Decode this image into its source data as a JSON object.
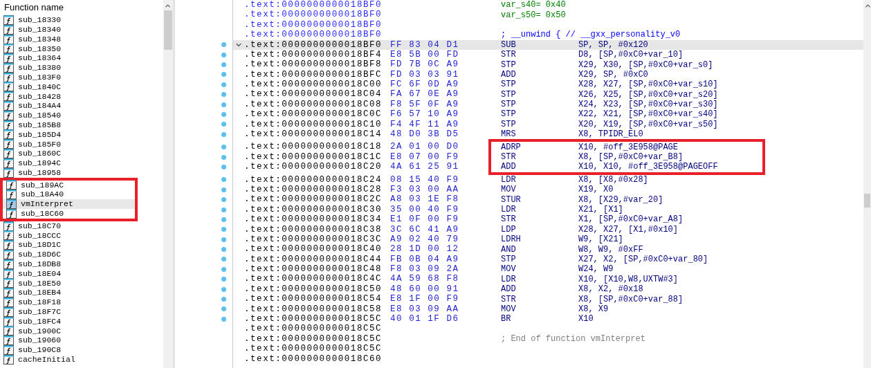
{
  "function_list": {
    "header": "Function name",
    "items": [
      {
        "name": "sub_18330",
        "selected": false,
        "framed": false
      },
      {
        "name": "sub_18340",
        "selected": false,
        "framed": false
      },
      {
        "name": "sub_18348",
        "selected": false,
        "framed": false
      },
      {
        "name": "sub_18350",
        "selected": false,
        "framed": false
      },
      {
        "name": "sub_18364",
        "selected": false,
        "framed": false
      },
      {
        "name": "sub_18380",
        "selected": false,
        "framed": false
      },
      {
        "name": "sub_183F0",
        "selected": false,
        "framed": false
      },
      {
        "name": "sub_1840C",
        "selected": false,
        "framed": false
      },
      {
        "name": "sub_18428",
        "selected": false,
        "framed": false
      },
      {
        "name": "sub_184A4",
        "selected": false,
        "framed": false
      },
      {
        "name": "sub_18540",
        "selected": false,
        "framed": false
      },
      {
        "name": "sub_185B8",
        "selected": false,
        "framed": false
      },
      {
        "name": "sub_185D4",
        "selected": false,
        "framed": false
      },
      {
        "name": "sub_185F0",
        "selected": false,
        "framed": false
      },
      {
        "name": "sub_1860C",
        "selected": false,
        "framed": false
      },
      {
        "name": "sub_1894C",
        "selected": false,
        "framed": false
      },
      {
        "name": "sub_18958",
        "selected": false,
        "framed": false
      },
      {
        "name": "sub_189AC",
        "selected": false,
        "framed": true
      },
      {
        "name": "sub_18A40",
        "selected": false,
        "framed": true
      },
      {
        "name": "vmInterpret",
        "selected": true,
        "framed": true
      },
      {
        "name": "sub_18C60",
        "selected": false,
        "framed": true
      },
      {
        "name": "sub_18C70",
        "selected": false,
        "framed": false
      },
      {
        "name": "sub_18CCC",
        "selected": false,
        "framed": false
      },
      {
        "name": "sub_18D1C",
        "selected": false,
        "framed": false
      },
      {
        "name": "sub_18D6C",
        "selected": false,
        "framed": false
      },
      {
        "name": "sub_18DB8",
        "selected": false,
        "framed": false
      },
      {
        "name": "sub_18E04",
        "selected": false,
        "framed": false
      },
      {
        "name": "sub_18E50",
        "selected": false,
        "framed": false
      },
      {
        "name": "sub_18EB4",
        "selected": false,
        "framed": false
      },
      {
        "name": "sub_18F18",
        "selected": false,
        "framed": false
      },
      {
        "name": "sub_18F7C",
        "selected": false,
        "framed": false
      },
      {
        "name": "sub_18FC4",
        "selected": false,
        "framed": false
      },
      {
        "name": "sub_1900C",
        "selected": false,
        "framed": false
      },
      {
        "name": "sub_19060",
        "selected": false,
        "framed": false
      },
      {
        "name": "sub_190C8",
        "selected": false,
        "framed": false
      },
      {
        "name": "cacheInitial",
        "selected": false,
        "framed": false
      }
    ]
  },
  "listing": {
    "rows": [
      {
        "kind": "var",
        "address": ".text:0000000000018BF0",
        "text": "var_s40= 0x40",
        "current": false,
        "marker": false,
        "collapsible": false,
        "framed": false
      },
      {
        "kind": "var",
        "address": ".text:0000000000018BF0",
        "text": "var_s50= 0x50",
        "current": false,
        "marker": false,
        "collapsible": false,
        "framed": false
      },
      {
        "kind": "blank",
        "address": ".text:0000000000018BF0",
        "current": false,
        "marker": false,
        "collapsible": false,
        "framed": false
      },
      {
        "kind": "comment",
        "address": ".text:0000000000018BF0",
        "text": "; __unwind { // __gxx_personality_v0",
        "current": false,
        "marker": false,
        "collapsible": false,
        "framed": false
      },
      {
        "kind": "code",
        "address": ".text:0000000000018BF0",
        "bytes": "FF 83 04 D1",
        "mnemonic": "SUB",
        "operands": "SP, SP, #0x120",
        "current": true,
        "marker": true,
        "collapsible": true,
        "framed": false
      },
      {
        "kind": "code",
        "address": ".text:0000000000018BF4",
        "bytes": "E8 5B 00 FD",
        "mnemonic": "STR",
        "operands": "D8, [SP,#0xC0+var_10]",
        "current": false,
        "marker": true,
        "collapsible": false,
        "framed": false
      },
      {
        "kind": "code",
        "address": ".text:0000000000018BF8",
        "bytes": "FD 7B 0C A9",
        "mnemonic": "STP",
        "operands": "X29, X30, [SP,#0xC0+var_s0]",
        "current": false,
        "marker": true,
        "collapsible": false,
        "framed": false
      },
      {
        "kind": "code",
        "address": ".text:0000000000018BFC",
        "bytes": "FD 03 03 91",
        "mnemonic": "ADD",
        "operands": "X29, SP, #0xC0",
        "current": false,
        "marker": true,
        "collapsible": false,
        "framed": false
      },
      {
        "kind": "code",
        "address": ".text:0000000000018C00",
        "bytes": "FC 6F 0D A9",
        "mnemonic": "STP",
        "operands": "X28, X27, [SP,#0xC0+var_s10]",
        "current": false,
        "marker": true,
        "collapsible": false,
        "framed": false
      },
      {
        "kind": "code",
        "address": ".text:0000000000018C04",
        "bytes": "FA 67 0E A9",
        "mnemonic": "STP",
        "operands": "X26, X25, [SP,#0xC0+var_s20]",
        "current": false,
        "marker": true,
        "collapsible": false,
        "framed": false
      },
      {
        "kind": "code",
        "address": ".text:0000000000018C08",
        "bytes": "F8 5F 0F A9",
        "mnemonic": "STP",
        "operands": "X24, X23, [SP,#0xC0+var_s30]",
        "current": false,
        "marker": true,
        "collapsible": false,
        "framed": false
      },
      {
        "kind": "code",
        "address": ".text:0000000000018C0C",
        "bytes": "F6 57 10 A9",
        "mnemonic": "STP",
        "operands": "X22, X21, [SP,#0xC0+var_s40]",
        "current": false,
        "marker": true,
        "collapsible": false,
        "framed": false
      },
      {
        "kind": "code",
        "address": ".text:0000000000018C10",
        "bytes": "F4 4F 11 A9",
        "mnemonic": "STP",
        "operands": "X20, X19, [SP,#0xC0+var_s50]",
        "current": false,
        "marker": true,
        "collapsible": false,
        "framed": false
      },
      {
        "kind": "code",
        "address": ".text:0000000000018C14",
        "bytes": "48 D0 3B D5",
        "mnemonic": "MRS",
        "operands": "X8, TPIDR_EL0",
        "current": false,
        "marker": true,
        "collapsible": false,
        "framed": false
      },
      {
        "kind": "code",
        "address": ".text:0000000000018C18",
        "bytes": "2A 01 00 D0",
        "mnemonic": "ADRP",
        "operands": "X10, #off_3E958@PAGE",
        "current": false,
        "marker": true,
        "collapsible": false,
        "framed": true
      },
      {
        "kind": "code",
        "address": ".text:0000000000018C1C",
        "bytes": "E8 07 00 F9",
        "mnemonic": "STR",
        "operands": "X8, [SP,#0xC0+var_B8]",
        "current": false,
        "marker": true,
        "collapsible": false,
        "framed": true
      },
      {
        "kind": "code",
        "address": ".text:0000000000018C20",
        "bytes": "4A 61 25 91",
        "mnemonic": "ADD",
        "operands": "X10, X10, #off_3E958@PAGEOFF",
        "current": false,
        "marker": true,
        "collapsible": false,
        "framed": true
      },
      {
        "kind": "code",
        "address": ".text:0000000000018C24",
        "bytes": "08 15 40 F9",
        "mnemonic": "LDR",
        "operands": "X8, [X8,#0x28]",
        "current": false,
        "marker": true,
        "collapsible": false,
        "framed": false
      },
      {
        "kind": "code",
        "address": ".text:0000000000018C28",
        "bytes": "F3 03 00 AA",
        "mnemonic": "MOV",
        "operands": "X19, X0",
        "current": false,
        "marker": true,
        "collapsible": false,
        "framed": false
      },
      {
        "kind": "code",
        "address": ".text:0000000000018C2C",
        "bytes": "A8 03 1E F8",
        "mnemonic": "STUR",
        "operands": "X8, [X29,#var_20]",
        "current": false,
        "marker": true,
        "collapsible": false,
        "framed": false
      },
      {
        "kind": "code",
        "address": ".text:0000000000018C30",
        "bytes": "35 00 40 F9",
        "mnemonic": "LDR",
        "operands": "X21, [X1]",
        "current": false,
        "marker": true,
        "collapsible": false,
        "framed": false
      },
      {
        "kind": "code",
        "address": ".text:0000000000018C34",
        "bytes": "E1 0F 00 F9",
        "mnemonic": "STR",
        "operands": "X1, [SP,#0xC0+var_A8]",
        "current": false,
        "marker": true,
        "collapsible": false,
        "framed": false
      },
      {
        "kind": "code",
        "address": ".text:0000000000018C38",
        "bytes": "3C 6C 41 A9",
        "mnemonic": "LDP",
        "operands": "X28, X27, [X1,#0x10]",
        "current": false,
        "marker": true,
        "collapsible": false,
        "framed": false
      },
      {
        "kind": "code",
        "address": ".text:0000000000018C3C",
        "bytes": "A9 02 40 79",
        "mnemonic": "LDRH",
        "operands": "W9, [X21]",
        "current": false,
        "marker": true,
        "collapsible": false,
        "framed": false
      },
      {
        "kind": "code",
        "address": ".text:0000000000018C40",
        "bytes": "28 1D 00 12",
        "mnemonic": "AND",
        "operands": "W8, W9, #0xFF",
        "current": false,
        "marker": true,
        "collapsible": false,
        "framed": false
      },
      {
        "kind": "code",
        "address": ".text:0000000000018C44",
        "bytes": "FB 0B 04 A9",
        "mnemonic": "STP",
        "operands": "X27, X2, [SP,#0xC0+var_80]",
        "current": false,
        "marker": true,
        "collapsible": false,
        "framed": false
      },
      {
        "kind": "code",
        "address": ".text:0000000000018C48",
        "bytes": "F8 03 09 2A",
        "mnemonic": "MOV",
        "operands": "W24, W9",
        "current": false,
        "marker": true,
        "collapsible": false,
        "framed": false
      },
      {
        "kind": "code",
        "address": ".text:0000000000018C4C",
        "bytes": "4A 59 68 F8",
        "mnemonic": "LDR",
        "operands": "X10, [X10,W8,UXTW#3]",
        "current": false,
        "marker": true,
        "collapsible": false,
        "framed": false
      },
      {
        "kind": "code",
        "address": ".text:0000000000018C50",
        "bytes": "48 60 00 91",
        "mnemonic": "ADD",
        "operands": "X8, X2, #0x18",
        "current": false,
        "marker": true,
        "collapsible": false,
        "framed": false
      },
      {
        "kind": "code",
        "address": ".text:0000000000018C54",
        "bytes": "E8 1F 00 F9",
        "mnemonic": "STR",
        "operands": "X8, [SP,#0xC0+var_88]",
        "current": false,
        "marker": true,
        "collapsible": false,
        "framed": false
      },
      {
        "kind": "code",
        "address": ".text:0000000000018C58",
        "bytes": "E8 03 09 AA",
        "mnemonic": "MOV",
        "operands": "X8, X9",
        "current": false,
        "marker": true,
        "collapsible": false,
        "framed": false
      },
      {
        "kind": "code",
        "address": ".text:0000000000018C5C",
        "bytes": "40 01 1F D6",
        "mnemonic": "BR",
        "operands": "X10",
        "current": false,
        "marker": true,
        "collapsible": false,
        "framed": false
      },
      {
        "kind": "blank",
        "address": ".text:0000000000018C5C",
        "current": false,
        "marker": false,
        "collapsible": false,
        "framed": false
      },
      {
        "kind": "end_comment",
        "address": ".text:0000000000018C5C",
        "text": "; End of function vmInterpret",
        "current": false,
        "marker": false,
        "collapsible": false,
        "framed": false
      },
      {
        "kind": "blank",
        "address": ".text:0000000000018C5C",
        "current": false,
        "marker": false,
        "collapsible": false,
        "framed": false
      },
      {
        "kind": "blank",
        "address": ".text:0000000000018C60",
        "current": false,
        "marker": false,
        "collapsible": false,
        "framed": false
      }
    ]
  }
}
